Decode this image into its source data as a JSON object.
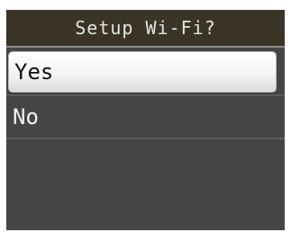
{
  "screen": {
    "title": "Setup Wi-Fi?",
    "options": [
      {
        "label": "Yes",
        "selected": true
      },
      {
        "label": "No",
        "selected": false
      }
    ]
  }
}
